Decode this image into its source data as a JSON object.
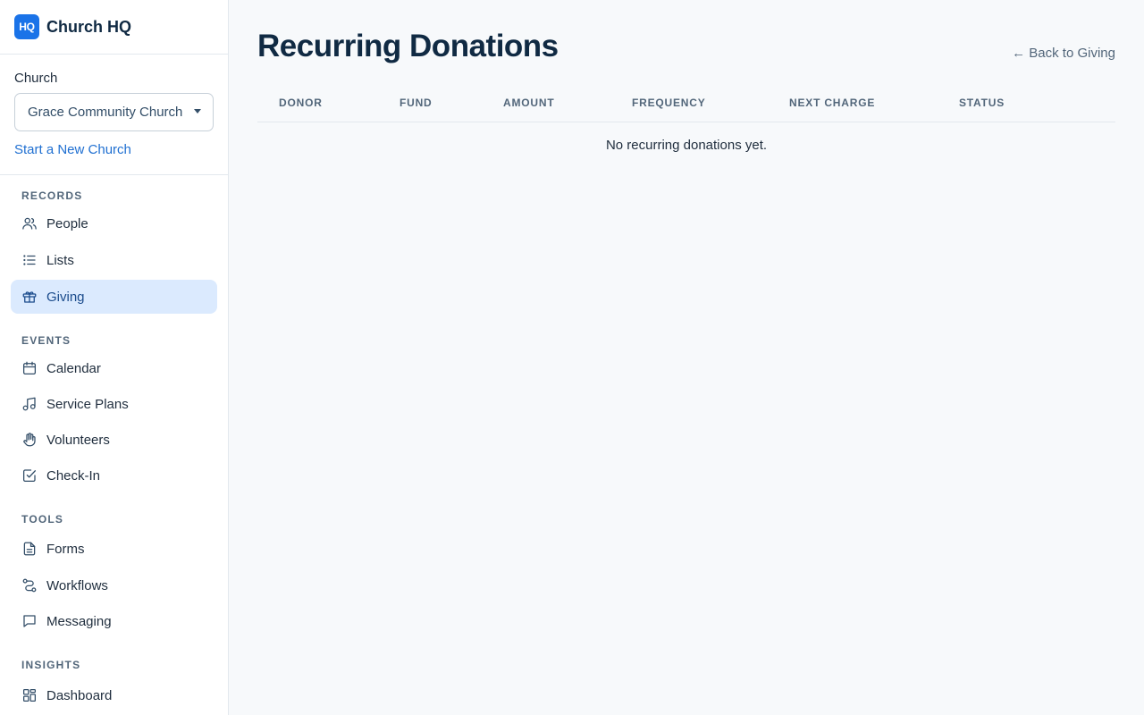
{
  "brand": {
    "logo_text": "HQ",
    "name": "Church HQ",
    "accent_color": "#1a73e8"
  },
  "church": {
    "label": "Church",
    "selected": "Grace Community Church",
    "new_church_link": "Start a New Church"
  },
  "nav": {
    "sections": [
      {
        "heading": "RECORDS",
        "items": [
          {
            "label": "People",
            "icon": "users-icon"
          },
          {
            "label": "Lists",
            "icon": "list-icon"
          },
          {
            "label": "Giving",
            "icon": "gift-icon",
            "active": true
          }
        ]
      },
      {
        "heading": "EVENTS",
        "items": [
          {
            "label": "Calendar",
            "icon": "calendar-icon"
          },
          {
            "label": "Service Plans",
            "icon": "music-note-icon"
          },
          {
            "label": "Volunteers",
            "icon": "hand-icon"
          },
          {
            "label": "Check-In",
            "icon": "check-square-icon"
          }
        ]
      },
      {
        "heading": "TOOLS",
        "items": [
          {
            "label": "Forms",
            "icon": "document-icon"
          },
          {
            "label": "Workflows",
            "icon": "workflow-icon"
          },
          {
            "label": "Messaging",
            "icon": "message-icon"
          }
        ]
      },
      {
        "heading": "INSIGHTS",
        "items": [
          {
            "label": "Dashboard",
            "icon": "dashboard-icon"
          }
        ]
      }
    ]
  },
  "main": {
    "title": "Recurring Donations",
    "back_link": "← Back to Giving",
    "table": {
      "columns": [
        "DONOR",
        "FUND",
        "AMOUNT",
        "FREQUENCY",
        "NEXT CHARGE",
        "STATUS"
      ],
      "empty_message": "No recurring donations yet."
    }
  }
}
